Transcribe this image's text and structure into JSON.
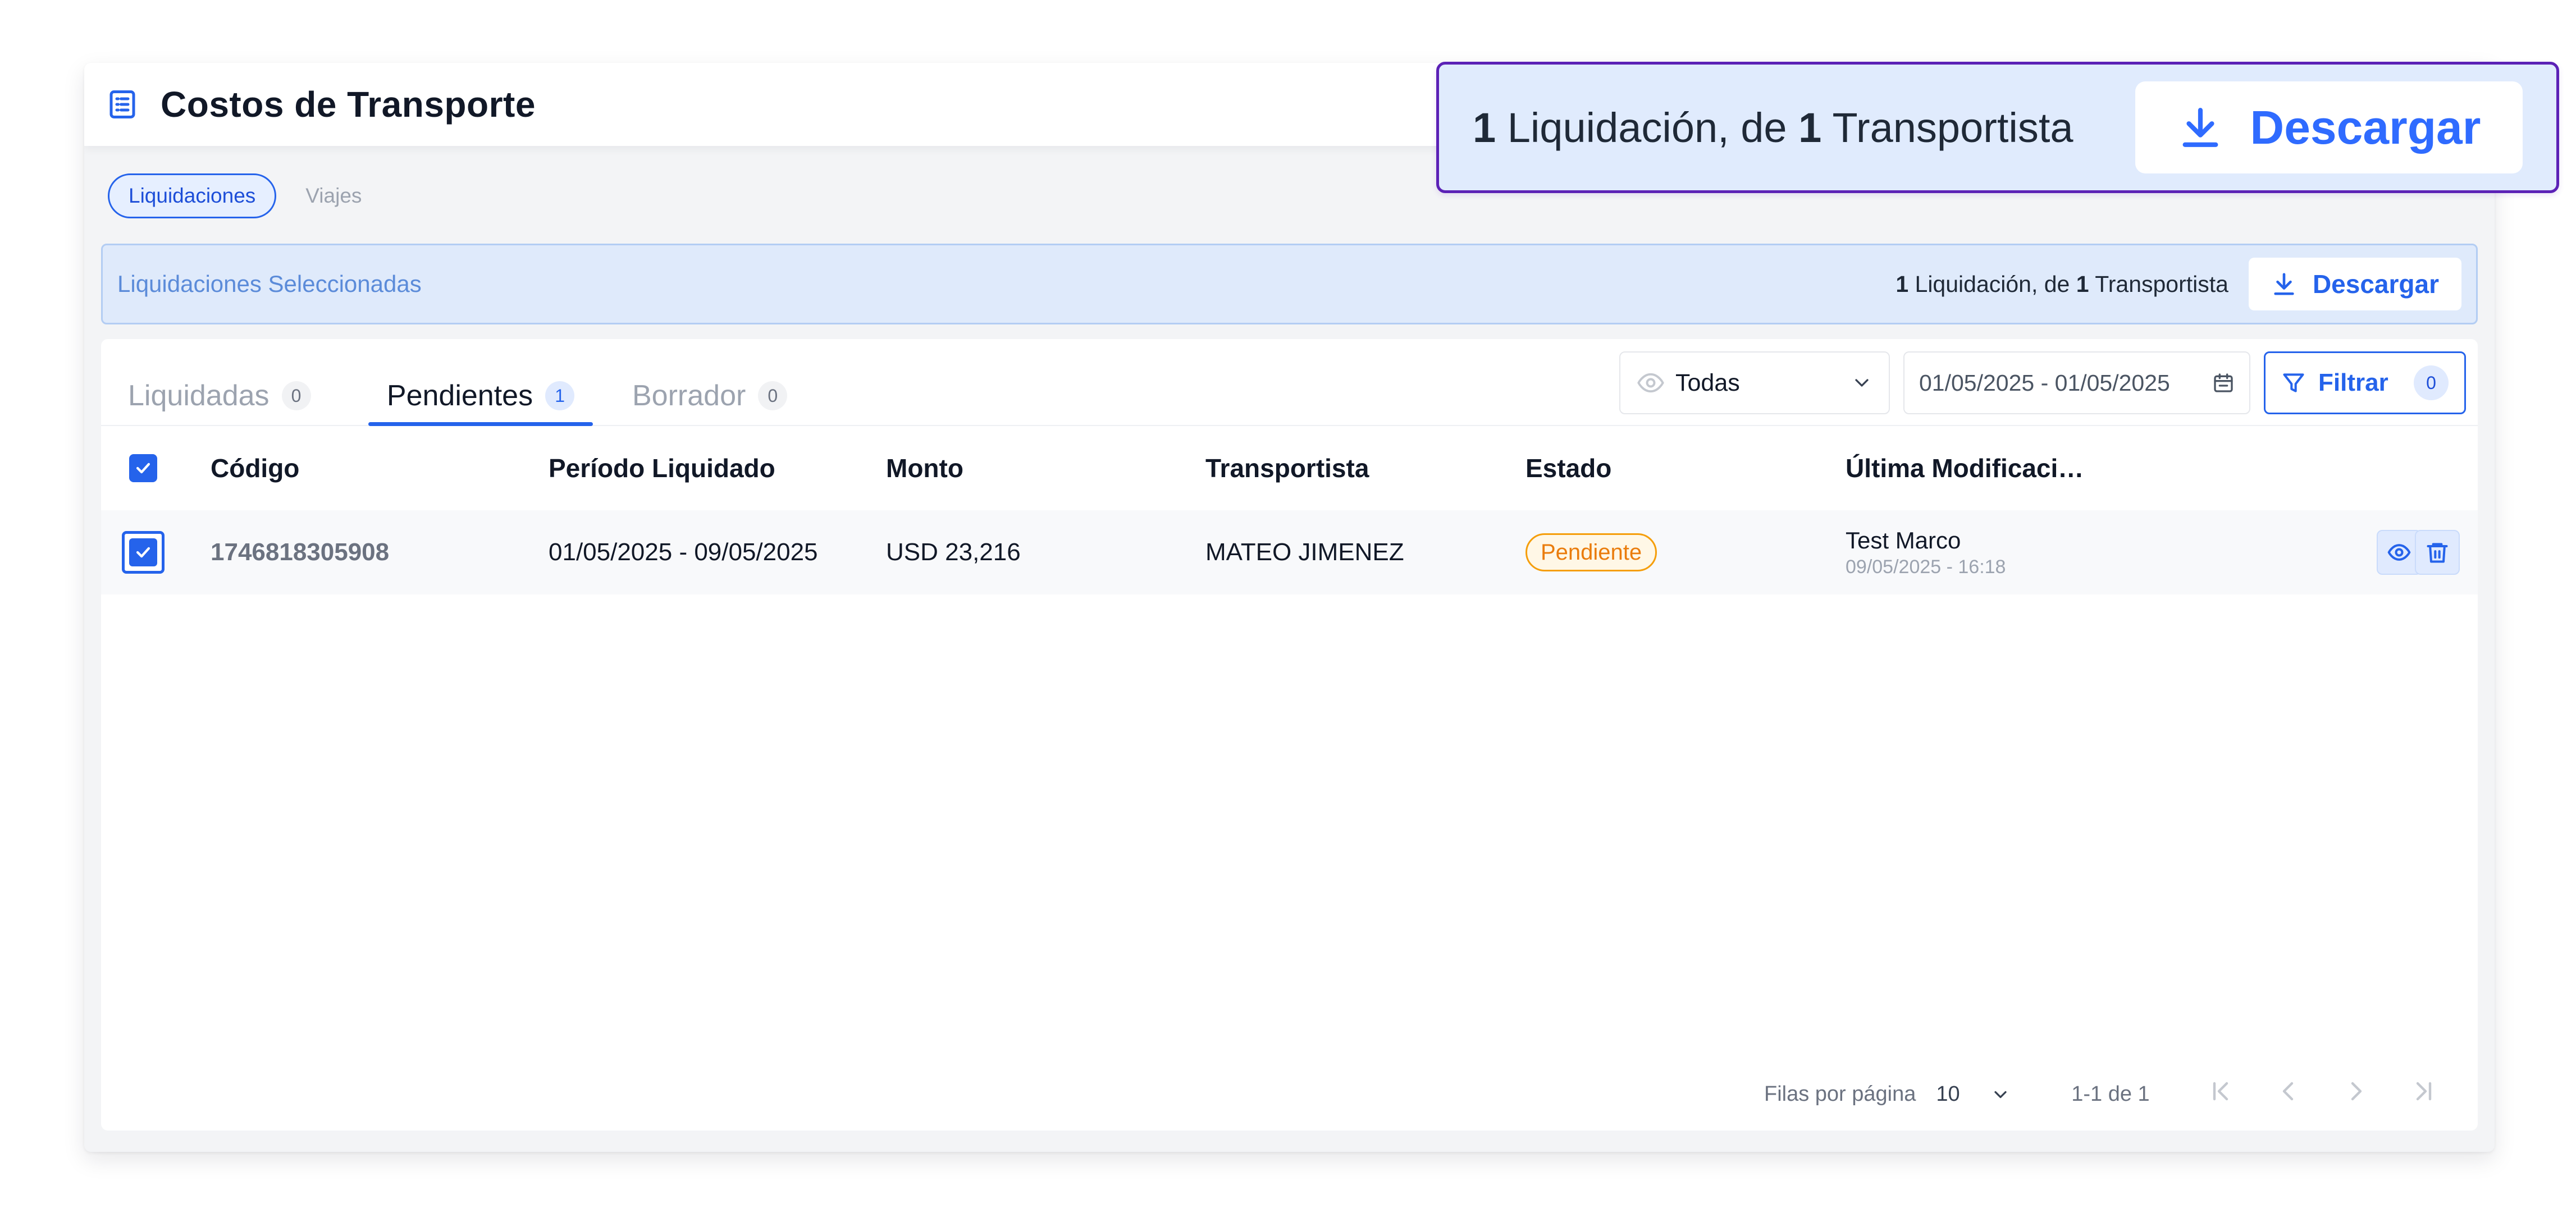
{
  "header": {
    "title": "Costos de Transporte",
    "icon": "document-list-icon"
  },
  "section_tabs": [
    {
      "label": "Liquidaciones",
      "active": true
    },
    {
      "label": "Viajes",
      "active": false
    }
  ],
  "selection_banner": {
    "label": "Liquidaciones Seleccionadas",
    "settlements_count": "1",
    "text_settlements": " Liquidación, de ",
    "carriers_count": "1",
    "text_carriers": " Transportista",
    "download_label": "Descargar"
  },
  "status_tabs": [
    {
      "label": "Liquidadas",
      "count": "0",
      "active": false
    },
    {
      "label": "Pendientes",
      "count": "1",
      "active": true
    },
    {
      "label": "Borrador",
      "count": "0",
      "active": false
    }
  ],
  "filters": {
    "visibility_value": "Todas",
    "date_range": "01/05/2025 - 01/05/2025",
    "filter_label": "Filtrar",
    "filter_count": "0"
  },
  "table": {
    "columns": [
      "Código",
      "Período Liquidado",
      "Monto",
      "Transportista",
      "Estado",
      "Última Modificaci…"
    ],
    "rows": [
      {
        "selected": true,
        "code": "1746818305908",
        "period": "01/05/2025 - 09/05/2025",
        "amount": "USD 23,216",
        "carrier": "MATEO JIMENEZ",
        "status": "Pendiente",
        "modified_by": "Test Marco",
        "modified_at": "09/05/2025 - 16:18"
      }
    ]
  },
  "pagination": {
    "rows_per_page_label": "Filas por página",
    "rows_per_page": "10",
    "range": "1-1 de 1"
  },
  "callout": {
    "settlements_count": "1",
    "text_settlements": " Liquidación, de ",
    "carriers_count": "1",
    "text_carriers": " Transportista",
    "download_label": "Descargar"
  },
  "colors": {
    "primary": "#2563eb",
    "banner_bg": "#dfeafb",
    "status_pending": "#f59e0b",
    "callout_border": "#5b21b6"
  }
}
